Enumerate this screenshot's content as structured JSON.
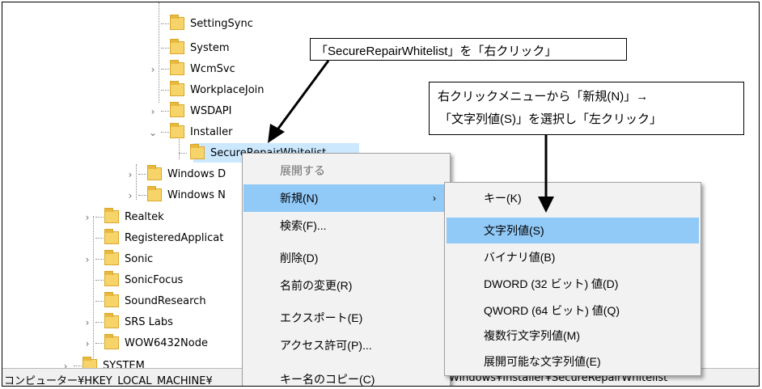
{
  "tree": {
    "items": [
      {
        "label": "SettingSync",
        "expander": ""
      },
      {
        "label": "System",
        "expander": ""
      },
      {
        "label": "WcmSvc",
        "expander": ">"
      },
      {
        "label": "WorkplaceJoin",
        "expander": ""
      },
      {
        "label": "WSDAPI",
        "expander": ">"
      },
      {
        "label": "Installer",
        "expander": "v"
      },
      {
        "label": "SecureRepairWhitelist",
        "expander": ""
      },
      {
        "label": "Windows D",
        "expander": ">"
      },
      {
        "label": "Windows N",
        "expander": ">"
      },
      {
        "label": "Realtek",
        "expander": ">"
      },
      {
        "label": "RegisteredApplicat",
        "expander": ""
      },
      {
        "label": "Sonic",
        "expander": ">"
      },
      {
        "label": "SonicFocus",
        "expander": ""
      },
      {
        "label": "SoundResearch",
        "expander": ""
      },
      {
        "label": "SRS Labs",
        "expander": ">"
      },
      {
        "label": "WOW6432Node",
        "expander": ">"
      },
      {
        "label": "SYSTEM",
        "expander": ">"
      }
    ]
  },
  "status_bar": {
    "path_left": "コンピューター¥HKEY_LOCAL_MACHINE¥",
    "path_right": "Windows¥Installer¥SecureRepairWhitelist"
  },
  "context_menu": {
    "items": [
      {
        "label": "展開する",
        "state": "disabled",
        "submenu": false
      },
      {
        "label": "新規(N)",
        "state": "highlighted",
        "submenu": true,
        "arrow": ">"
      },
      {
        "label": "検索(F)...",
        "state": "normal",
        "submenu": false
      },
      {
        "label": "削除(D)",
        "state": "normal",
        "submenu": false
      },
      {
        "label": "名前の変更(R)",
        "state": "normal",
        "submenu": false
      },
      {
        "label": "エクスポート(E)",
        "state": "normal",
        "submenu": false
      },
      {
        "label": "アクセス許可(P)...",
        "state": "normal",
        "submenu": false
      },
      {
        "label": "キー名のコピー(C)",
        "state": "normal",
        "submenu": false
      }
    ]
  },
  "submenu": {
    "items": [
      {
        "label": "キー(K)",
        "state": "normal"
      },
      {
        "label": "文字列値(S)",
        "state": "highlighted"
      },
      {
        "label": "バイナリ値(B)",
        "state": "normal"
      },
      {
        "label": "DWORD (32 ビット) 値(D)",
        "state": "normal"
      },
      {
        "label": "QWORD (64 ビット) 値(Q)",
        "state": "normal"
      },
      {
        "label": "複数行文字列値(M)",
        "state": "normal"
      },
      {
        "label": "展開可能な文字列値(E)",
        "state": "normal"
      }
    ]
  },
  "annotations": {
    "callout_1": "「SecureRepairWhitelist」を「右クリック」",
    "callout_2_line1": "右クリックメニューから「新規(N)」→",
    "callout_2_line2": "「文字列値(S)」を選択し「左クリック」"
  },
  "colors": {
    "highlight": "#91c9f7",
    "menu_bg": "#f2f2f2",
    "folder": "#f7d46a",
    "tree_selection": "#cce8ff"
  },
  "icons": {
    "folder": "folder-icon",
    "expand": "chevron-right-icon",
    "collapse": "chevron-down-icon",
    "submenu": "chevron-right-icon"
  }
}
